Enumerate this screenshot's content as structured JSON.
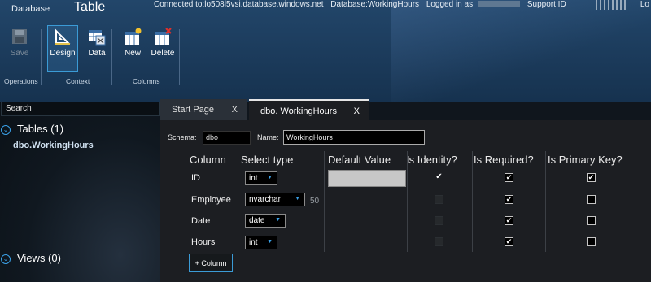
{
  "header": {
    "breadcrumb_database": "Database",
    "breadcrumb_table": "Table",
    "connection": "Connected to:lo508l5vsi.database.windows.net",
    "database": "Database:WorkingHours",
    "logged_in": "Logged in as",
    "support": "Support ID",
    "logoff": "Lo"
  },
  "toolbar": {
    "save_label": "Save",
    "design_label": "Design",
    "data_label": "Data",
    "new_label": "New",
    "delete_label": "Delete",
    "group_operations": "Operations",
    "group_context": "Context",
    "group_columns": "Columns"
  },
  "sidebar": {
    "search_placeholder": "Search",
    "tables_header": "Tables (1)",
    "tables": [
      "dbo.WorkingHours"
    ],
    "views_header": "Views (0)"
  },
  "tabs": [
    {
      "label": "Start Page",
      "close": "X"
    },
    {
      "label": "dbo. WorkingHours",
      "close": "X"
    }
  ],
  "form": {
    "schema_label": "Schema:",
    "schema_value": "dbo",
    "name_label": "Name:",
    "name_value": "WorkingHours"
  },
  "grid": {
    "headers": [
      "Column",
      "Select type",
      "Default Value",
      "Is Identity?",
      "Is Required?",
      "Is Primary Key?"
    ],
    "rows": [
      {
        "column": "ID",
        "type": "int",
        "length": "",
        "identity": true,
        "required": true,
        "primary": true
      },
      {
        "column": "Employee",
        "type": "nvarchar",
        "length": "50",
        "identity": false,
        "required": true,
        "primary": false
      },
      {
        "column": "Date",
        "type": "date",
        "length": "",
        "identity": false,
        "required": true,
        "primary": false
      },
      {
        "column": "Hours",
        "type": "int",
        "length": "",
        "identity": false,
        "required": true,
        "primary": false
      }
    ],
    "add_column_label": "+ Column"
  },
  "colors": {
    "accent": "#3aa0e6",
    "header_bg": "#1b3a5a",
    "panel_bg": "#1c1e22"
  }
}
